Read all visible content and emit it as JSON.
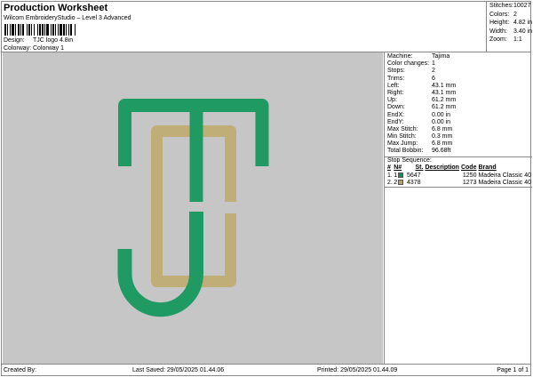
{
  "header": {
    "title": "Production Worksheet",
    "subtitle": "Wilcom EmbroideryStudio – Level 3 Advanced",
    "design_label": "Design:",
    "design": "TJC logo 4.8in",
    "colorway_label": "Colorway:",
    "colorway": "Colorway 1"
  },
  "stats": [
    {
      "label": "Stitches:",
      "value": "10027"
    },
    {
      "label": "Colors:",
      "value": "2"
    },
    {
      "label": "Height:",
      "value": "4.82 in"
    },
    {
      "label": "Width:",
      "value": "3.40 in"
    },
    {
      "label": "Zoom:",
      "value": "1:1"
    }
  ],
  "machine": [
    {
      "label": "Machine:",
      "value": "Tajima"
    },
    {
      "label": "Color changes:",
      "value": "1"
    },
    {
      "label": "Stops:",
      "value": "2"
    },
    {
      "label": "Trims:",
      "value": "6"
    },
    {
      "label": "Left:",
      "value": "43.1 mm"
    },
    {
      "label": "Right:",
      "value": "43.1 mm"
    },
    {
      "label": "Up:",
      "value": "61.2 mm"
    },
    {
      "label": "Down:",
      "value": "61.2 mm"
    },
    {
      "label": "EndX:",
      "value": "0.00 in"
    },
    {
      "label": "EndY:",
      "value": "0.00 in"
    },
    {
      "label": "Max Stitch:",
      "value": "6.8 mm"
    },
    {
      "label": "Min Stitch:",
      "value": "0.3 mm"
    },
    {
      "label": "Max Jump:",
      "value": "6.8 mm"
    },
    {
      "label": "Total Bobbin:",
      "value": "96.68ft"
    }
  ],
  "stop_sequence": {
    "title": "Stop Sequence:",
    "columns": [
      "#",
      "N#",
      "St.",
      "Description",
      "Code",
      "Brand"
    ],
    "rows": [
      {
        "num": "1.",
        "n": "1",
        "color": "#1e8a5a",
        "st": "5647",
        "desc": "",
        "code": "1250",
        "brand": "Madeira Classic 40"
      },
      {
        "num": "2.",
        "n": "2",
        "color": "#b3a06c",
        "st": "4378",
        "desc": "",
        "code": "1273",
        "brand": "Madeira Classic 40"
      }
    ]
  },
  "colors": {
    "green": "#1f9a62",
    "gold": "#bfae78",
    "canvas": "#c6c6c6"
  },
  "footer": {
    "created": "Created By:",
    "saved": "Last Saved: 29/05/2025 01.44.06",
    "printed": "Printed: 29/05/2025 01.44.09",
    "page": "Page 1 of 1"
  }
}
